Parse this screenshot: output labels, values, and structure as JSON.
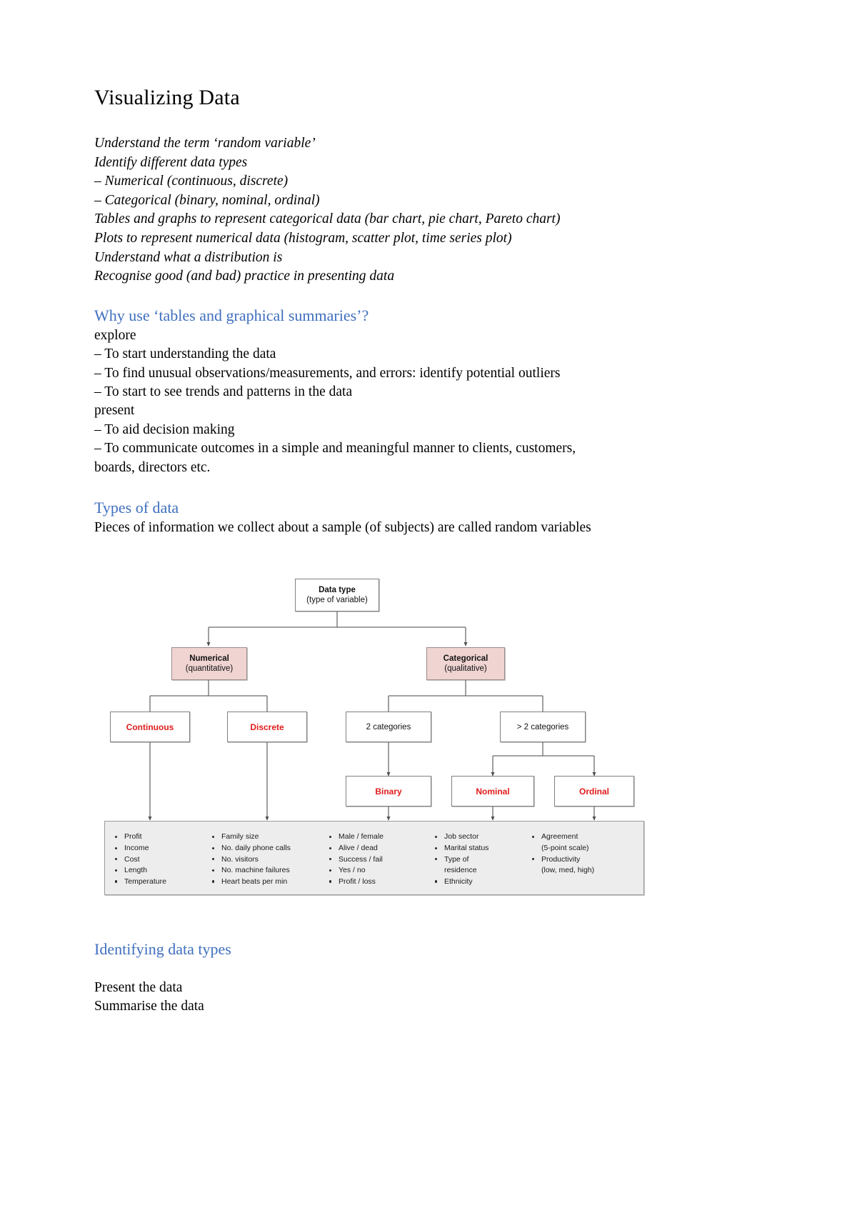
{
  "document": {
    "title": "Visualizing Data",
    "objectives": [
      "Understand the term ‘random variable’",
      "Identify different data types",
      "– Numerical (continuous, discrete)",
      "– Categorical (binary, nominal, ordinal)",
      "Tables and graphs to represent categorical data (bar chart, pie chart, Pareto chart)",
      "Plots to represent numerical data (histogram, scatter plot, time series plot)",
      "Understand what a distribution is",
      "Recognise good (and bad) practice in presenting data"
    ],
    "sections": [
      {
        "heading": "Why use ‘tables and graphical summaries’?",
        "lines": [
          "explore",
          "–  To start understanding the data",
          "–  To find unusual observations/measurements, and errors: identify potential outliers",
          "–  To start to see trends and patterns in the data",
          "present",
          "–  To aid decision making",
          "–  To communicate outcomes in a simple and meaningful manner to clients, customers,",
          "boards, directors etc."
        ]
      },
      {
        "heading": "Types of data",
        "lines": [
          "Pieces of information we collect about a sample (of subjects) are called random variables"
        ]
      }
    ],
    "bottom": {
      "heading": "Identifying data types",
      "lines": [
        "Present the data",
        "Summarise the data"
      ]
    }
  },
  "diagram": {
    "nodes": {
      "root": {
        "line1": "Data type",
        "line2": "(type of variable)"
      },
      "numerical": {
        "line1": "Numerical",
        "line2": "(quantitative)"
      },
      "categorical": {
        "line1": "Categorical",
        "line2": "(qualitative)"
      },
      "continuous": {
        "line1": "Continuous"
      },
      "discrete": {
        "line1": "Discrete"
      },
      "two_categories": {
        "line1": "2 categories"
      },
      "more_categories": {
        "line1": "> 2 categories"
      },
      "binary": {
        "line1": "Binary"
      },
      "nominal": {
        "line1": "Nominal"
      },
      "ordinal": {
        "line1": "Ordinal"
      }
    },
    "examples": [
      {
        "items": [
          {
            "text": "Profit"
          },
          {
            "text": "Income"
          },
          {
            "text": "Cost"
          },
          {
            "text": "Length"
          },
          {
            "text": "Temperature"
          }
        ]
      },
      {
        "items": [
          {
            "text": "Family size"
          },
          {
            "text": "No. daily phone calls"
          },
          {
            "text": "No. visitors"
          },
          {
            "text": "No. machine failures"
          },
          {
            "text": "Heart beats per min"
          }
        ]
      },
      {
        "items": [
          {
            "text": "Male / female"
          },
          {
            "text": "Alive / dead"
          },
          {
            "text": "Success / fail"
          },
          {
            "text": "Yes / no"
          },
          {
            "text": "Profit / loss"
          }
        ]
      },
      {
        "items": [
          {
            "text": "Job sector"
          },
          {
            "text": "Marital status"
          },
          {
            "text": "Type of",
            "sub": "residence"
          },
          {
            "text": "Ethnicity"
          }
        ]
      },
      {
        "items": [
          {
            "text": "Agreement",
            "sub": "(5-point scale)"
          },
          {
            "text": "Productivity",
            "sub": "(low, med, high)"
          }
        ]
      }
    ],
    "colors": {
      "accent_heading": "#3f6fbf",
      "node_red": "#e01b1b",
      "node_pink_fill": "#efd4d2",
      "examples_fill": "#ededed",
      "connector": "#6b6b6b"
    }
  }
}
